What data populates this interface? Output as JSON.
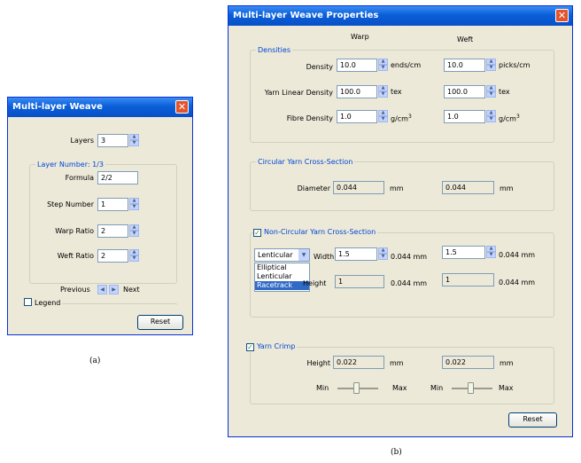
{
  "dialog_a": {
    "title": "Multi-layer Weave",
    "close_glyph": "✕",
    "layers_label": "Layers",
    "layers_value": "3",
    "layer_group_label": "Layer Number: 1/3",
    "formula_label": "Formula",
    "formula_value": "2/2",
    "step_label": "Step Number",
    "step_value": "1",
    "warp_ratio_label": "Warp Ratio",
    "warp_ratio_value": "2",
    "weft_ratio_label": "Weft Ratio",
    "weft_ratio_value": "2",
    "previous_label": "Previous",
    "next_label": "Next",
    "legend_label": "Legend",
    "reset_label": "Reset",
    "caption": "(a)"
  },
  "dialog_b": {
    "title": "Multi-layer Weave Properties",
    "close_glyph": "✕",
    "col_warp": "Warp",
    "col_weft": "Weft",
    "densities_label": "Densities",
    "density_label": "Density",
    "density_warp": "10.0",
    "density_warp_unit": "ends/cm",
    "density_weft": "10.0",
    "density_weft_unit": "picks/cm",
    "yarn_linear_label": "Yarn Linear Density",
    "yarn_linear_warp": "100.0",
    "yarn_linear_weft": "100.0",
    "tex_unit": "tex",
    "fibre_label": "Fibre Density",
    "fibre_warp": "1.0",
    "fibre_weft": "1.0",
    "fibre_unit": "g/cm",
    "fibre_unit_exp": "3",
    "circular_label": "Circular Yarn Cross-Section",
    "diameter_label": "Diameter",
    "diameter_warp": "0.044",
    "diameter_weft": "0.044",
    "mm_unit": "mm",
    "noncircular_label": "Non-Circular Yarn Cross-Section",
    "shape_selected": "Lenticular",
    "shape_options": [
      "Elliptical",
      "Lenticular",
      "Racetrack"
    ],
    "width_label": "Width",
    "width_warp": "1.5",
    "width_weft": "1.5",
    "width_warp_unit": "0.044 mm",
    "width_weft_unit": "0.044 mm",
    "height_label_partial": "Height",
    "height_warp": "1",
    "height_weft": "1",
    "height_warp_unit": "0.044 mm",
    "height_weft_unit": "0.044 mm",
    "crimp_label": "Yarn Crimp",
    "crimp_height_label": "Height",
    "crimp_height_warp": "0.022",
    "crimp_height_weft": "0.022",
    "min_label": "Min",
    "max_label": "Max",
    "reset_label": "Reset",
    "caption": "(b)"
  }
}
